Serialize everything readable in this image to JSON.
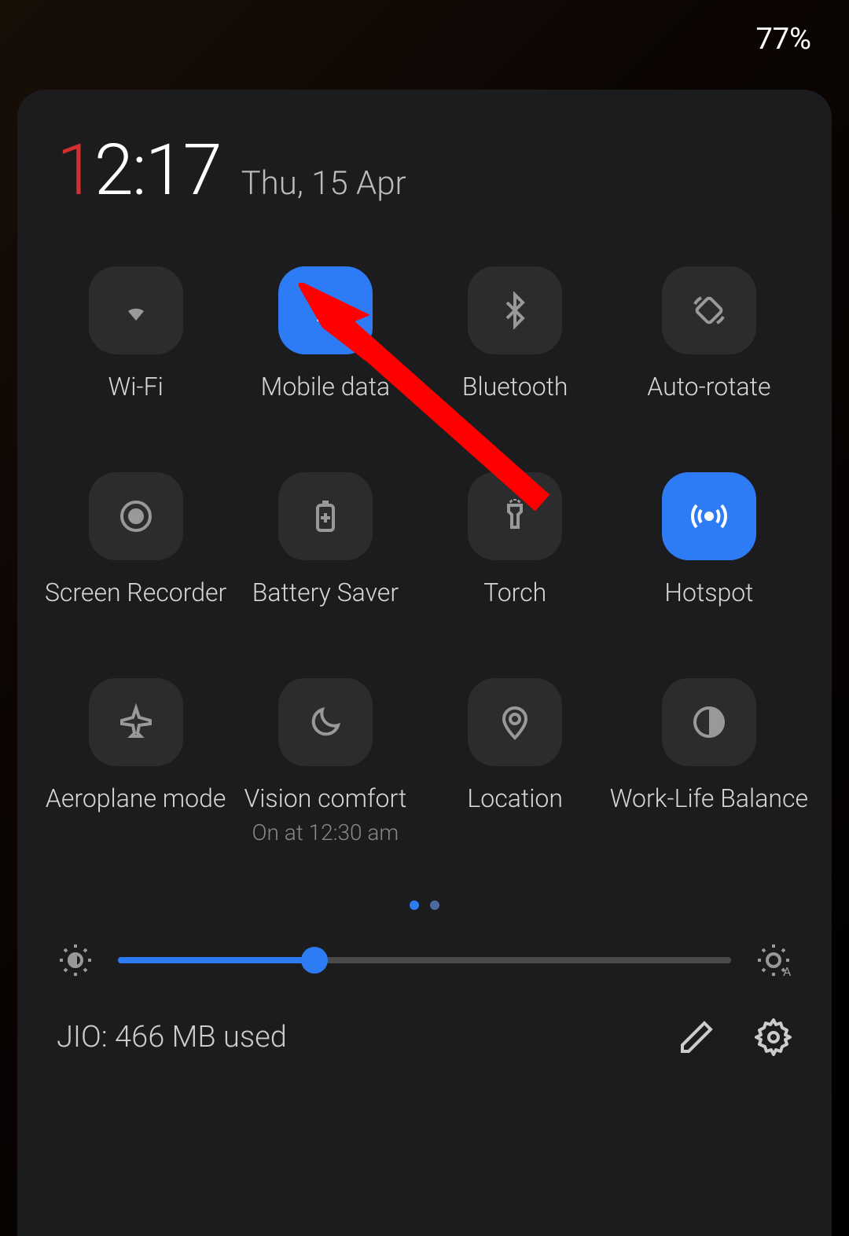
{
  "status_bar": {
    "battery_percent": "77%"
  },
  "clock": {
    "hour_accent": "1",
    "rest": "2:17",
    "date": "Thu, 15 Apr"
  },
  "tiles": [
    {
      "label": "Wi-Fi",
      "active": false,
      "icon": "wifi"
    },
    {
      "label": "Mobile data",
      "active": true,
      "icon": "mobile-data"
    },
    {
      "label": "Bluetooth",
      "active": false,
      "icon": "bluetooth"
    },
    {
      "label": "Auto-rotate",
      "active": false,
      "icon": "auto-rotate"
    },
    {
      "label": "Screen Recorder",
      "active": false,
      "icon": "record"
    },
    {
      "label": "Battery Saver",
      "active": false,
      "icon": "battery"
    },
    {
      "label": "Torch",
      "active": false,
      "icon": "torch"
    },
    {
      "label": "Hotspot",
      "active": true,
      "icon": "hotspot"
    },
    {
      "label": "Aeroplane mode",
      "active": false,
      "icon": "airplane"
    },
    {
      "label": "Vision comfort",
      "sublabel": "On at 12:30 am",
      "active": false,
      "icon": "moon"
    },
    {
      "label": "Location",
      "active": false,
      "icon": "location"
    },
    {
      "label": "Work-Life Balance",
      "active": false,
      "icon": "balance"
    }
  ],
  "pagination": {
    "current": 0,
    "total": 2
  },
  "brightness": {
    "percent": 32
  },
  "footer": {
    "status": "JIO: 466 MB used"
  },
  "annotation": {
    "arrow_target": "mobile-data-tile"
  }
}
